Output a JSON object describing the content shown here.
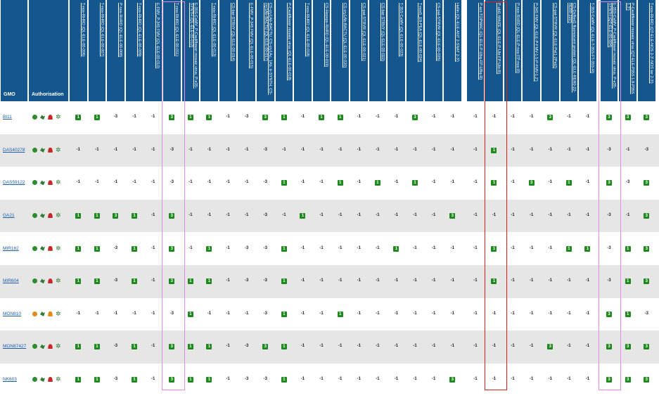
{
  "header": {
    "gmo_label": "GMO",
    "auth_label": "Authorisation"
  },
  "columns": [
    "T-nos-RHRD (QL-ELE-00-006)",
    "T-nos-RHRD (QL-ELE-00-007)",
    "P-nos-RHRD (QL-ELE-00-008)",
    "T-nos-RHRD (QL-ELE-00-009)",
    "E-FMV_P-345 FMV (QL-ELE-00-010)",
    "T-nos-RHRD (QL-ELE-00-011)",
    "E-35S-CaMV_P-Cauliflower mosaic virus, P-e35-SYNTH (QL-ELE-00-012)",
    "T-nos-RHRD (QL-ELE-00-013)",
    "CS-bar-STRHY (QL-ELE-00-014)",
    "E-FMV_P-345 FMV (QL-ELE-00-015)",
    "CS-cry1Ab-BACTU, CS-cry1Ac, 1Ab, tr-SYNTH, CS-cry1Ab-BACTU (QL-ELE-00-017)",
    "P-Cauliflower mosaic virus (QL-ELE-00-018)",
    "T-nos-RHRD (QL-ELE-00-018)",
    "CS-Hepsps-RHRD (QL-ELE-00-019)",
    "CS-cry1Ab-BACTU (QL-ELE-00-020)",
    "CS-pat-STRVR (QL-ELE-00-021)",
    "CS-bar-STRHY (QL-ELE-00-022)",
    "T-35S CaMV (QL-ELE-00-023)",
    "T-nos5_E9-PEA (QL-ELE-00-024)",
    "CS-pat-STRVR (QL-ELE-00-025)",
    "Hellin (QL-ELE-ANT 2-SNAT 2-3')",
    "P-act-TOPMAC (QL-ELE-P-Ubq-FP-UBq-R)",
    "P-ubi1-MAIZE (QL-ELE-P-Ubi-FP-Ubi-R)",
    "P-nos-RHRD (QL-ELE-P-nos-FP-nos-R)",
    "P-345 FMV (QL-ELE-P-FMV-1.5-P-FMV-1.2')",
    "CS-pat-STRVR (QL-ELE-Pat1-2Pat2)",
    "CS-DsRed1 fluorescent protein (QL-ELE-RER0-22-RER0 220')",
    "T-35S CaMV (QL-ELE-T-35S-FT-35S-R)",
    "E-35S-CaMV_P-Cauliflower mosaic virus, P-e35-SYNTH (QT-ELE-00-004)",
    "P-Cauliflower mosaic virus (QT-ELE-P35S 1.8-P35S 1.3')",
    "T-nos-RHRD (QT-ELE-NOS 2-3'-NOS ter 2-3')"
  ],
  "rows": [
    {
      "name": "Bt11",
      "globe": "green",
      "car": "red",
      "values": [
        "1",
        "1",
        "-3",
        "-1",
        "-1",
        "3",
        "1",
        "1",
        "-1",
        "-3",
        "3",
        "1",
        "-1",
        "1",
        "1",
        "-1",
        "-1",
        "-1",
        "3",
        "-1",
        "-1",
        "-1",
        "-1",
        "-1",
        "-1",
        "3",
        "-1",
        "-1",
        "3",
        "3",
        "3"
      ]
    },
    {
      "name": "DAS40278",
      "globe": "green",
      "car": "red",
      "values": [
        "-1",
        "-1",
        "-1",
        "-1",
        "-1",
        "-3",
        "-1",
        "-1",
        "-1",
        "-1",
        "-3",
        "-1",
        "-1",
        "-1",
        "-1",
        "-1",
        "-1",
        "-1",
        "-1",
        "-1",
        "-1",
        "-1",
        "1",
        "-1",
        "-1",
        "-1",
        "-1",
        "-1",
        "-3",
        "-1",
        "-3"
      ]
    },
    {
      "name": "DAS59122",
      "globe": "green",
      "car": "red",
      "values": [
        "-1",
        "-1",
        "-1",
        "-1",
        "-1",
        "-3",
        "-1",
        "-1",
        "-1",
        "-1",
        "-3",
        "1",
        "-1",
        "-1",
        "1",
        "-1",
        "1",
        "-1",
        "1",
        "-1",
        "-1",
        "-1",
        "1",
        "-1",
        "3",
        "-1",
        "1",
        "-1",
        "3",
        "-3",
        "3"
      ]
    },
    {
      "name": "GA21",
      "globe": "green",
      "car": "red",
      "values": [
        "1",
        "1",
        "3",
        "1",
        "-1",
        "3",
        "-1",
        "-1",
        "-1",
        "-1",
        "-3",
        "-1",
        "1",
        "-1",
        "-1",
        "-1",
        "-1",
        "-1",
        "-1",
        "-1",
        "3",
        "-1",
        "-1",
        "-1",
        "-1",
        "-1",
        "-1",
        "-1",
        "-3",
        "-1",
        "3"
      ]
    },
    {
      "name": "MIR162",
      "globe": "green",
      "car": "red",
      "values": [
        "1",
        "1",
        "-3",
        "1",
        "-1",
        "3",
        "-1",
        "1",
        "-1",
        "-3",
        "-3",
        "1",
        "-1",
        "-1",
        "-1",
        "-1",
        "-1",
        "1",
        "-1",
        "-1",
        "-1",
        "-1",
        "1",
        "-1",
        "-1",
        "-1",
        "1",
        "1",
        "-3",
        "1",
        "3"
      ]
    },
    {
      "name": "MIR604",
      "globe": "green",
      "car": "red",
      "values": [
        "1",
        "1",
        "-3",
        "1",
        "-1",
        "3",
        "1",
        "1",
        "-1",
        "-3",
        "-3",
        "1",
        "-1",
        "-1",
        "-1",
        "-1",
        "-1",
        "-1",
        "-1",
        "-1",
        "-1",
        "-1",
        "1",
        "-1",
        "-1",
        "-1",
        "-1",
        "-1",
        "-3",
        "1",
        "3"
      ]
    },
    {
      "name": "MON810",
      "globe": "orange",
      "car": "orange",
      "values": [
        "-1",
        "-1",
        "-1",
        "-1",
        "-1",
        "-3",
        "1",
        "-1",
        "-1",
        "-1",
        "-3",
        "1",
        "-1",
        "-1",
        "1",
        "-1",
        "-1",
        "-1",
        "-1",
        "-1",
        "-1",
        "-1",
        "-1",
        "-1",
        "-1",
        "-1",
        "-1",
        "-1",
        "3",
        "1",
        "-3"
      ]
    },
    {
      "name": "MON87427",
      "globe": "green",
      "car": "red",
      "values": [
        "1",
        "1",
        "-3",
        "1",
        "-1",
        "3",
        "1",
        "1",
        "-1",
        "-3",
        "3",
        "1",
        "-1",
        "-1",
        "-1",
        "-1",
        "-1",
        "-1",
        "-1",
        "-1",
        "-1",
        "-1",
        "-1",
        "-1",
        "-1",
        "3",
        "-1",
        "-1",
        "3",
        "3",
        "3"
      ]
    },
    {
      "name": "NK603",
      "globe": "green",
      "car": "red",
      "values": [
        "1",
        "1",
        "-3",
        "1",
        "-1",
        "3",
        "1",
        "1",
        "-1",
        "-3",
        "-3",
        "1",
        "-1",
        "-1",
        "-1",
        "-1",
        "-1",
        "-1",
        "-1",
        "-1",
        "3",
        "-1",
        "-1",
        "-1",
        "-1",
        "-1",
        "-1",
        "-1",
        "3",
        "3",
        "3"
      ]
    }
  ],
  "icons": {
    "globe": "globe-icon",
    "bird": "bird-icon",
    "car": "car-icon",
    "flower": "flower-icon"
  },
  "colors": {
    "header_bg": "#14578e",
    "positive_badge": "#1e8a1e",
    "link": "#1a5db0",
    "highlight_pink": "#e58be9",
    "highlight_red": "#e31c1c"
  }
}
